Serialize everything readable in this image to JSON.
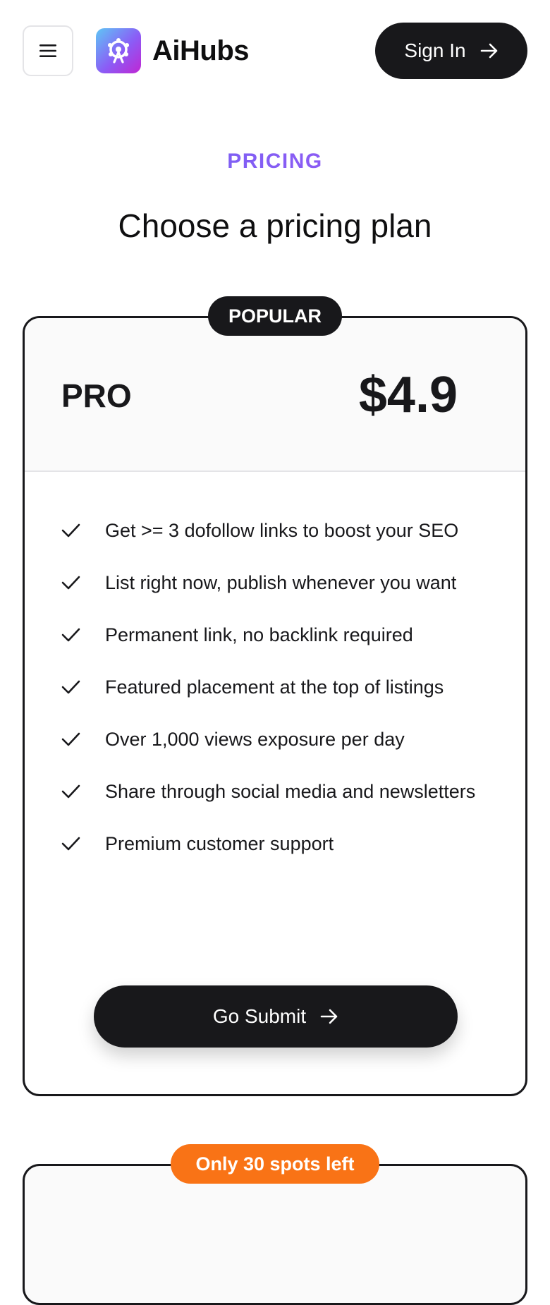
{
  "header": {
    "brand": "AiHubs",
    "sign_in_label": "Sign In"
  },
  "hero": {
    "eyebrow": "PRICING",
    "title": "Choose a pricing plan"
  },
  "plan": {
    "badge": "POPULAR",
    "name": "PRO",
    "price": "$4.9",
    "features": [
      "Get >= 3 dofollow links to boost your SEO",
      "List right now, publish whenever you want",
      "Permanent link, no backlink required",
      "Featured placement at the top of listings",
      "Over 1,000 views exposure per day",
      "Share through social media and newsletters",
      "Premium customer support"
    ],
    "cta_label": "Go Submit"
  },
  "next_plan": {
    "badge": "Only 30 spots left"
  },
  "colors": {
    "primary_dark": "#18181b",
    "accent_orange": "#f97316",
    "gradient_start": "#6366f1",
    "gradient_end": "#a855f7"
  }
}
